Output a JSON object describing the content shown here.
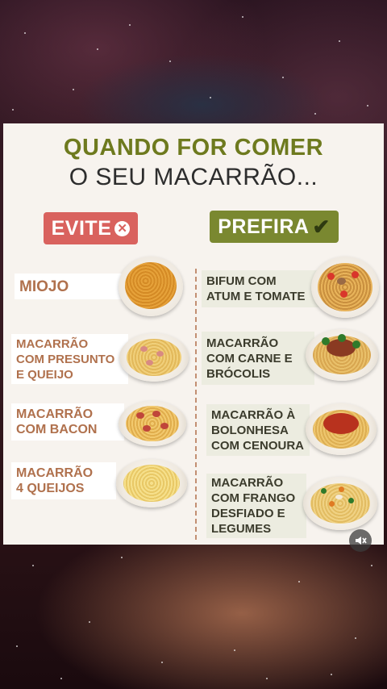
{
  "title": {
    "line1": "QUANDO FOR COMER",
    "line2": "O SEU MACARRÃO..."
  },
  "evite": {
    "label": "EVITE",
    "items": [
      {
        "text": "MIOJO"
      },
      {
        "text": "MACARRÃO\nCOM PRESUNTO\nE QUEIJO"
      },
      {
        "text": "MACARRÃO\nCOM BACON"
      },
      {
        "text": "MACARRÃO\n4 QUEIJOS"
      }
    ]
  },
  "prefira": {
    "label": "PREFIRA",
    "items": [
      {
        "text": "BIFUM COM\nATUM E TOMATE"
      },
      {
        "text": "MACARRÃO\nCOM CARNE E\nBRÓCOLIS"
      },
      {
        "text": "MACARRÃO À\nBOLONHESA\nCOM CENOURA"
      },
      {
        "text": "MACARRÃO\nCOM FRANGO\nDESFIADO E\nLEGUMES"
      }
    ]
  },
  "colors": {
    "title_green": "#6e7a1e",
    "evite_red": "#d9625e",
    "prefira_green": "#7a8830",
    "card_bg": "#f7f3ee"
  },
  "icons": {
    "evite": "x-circle-icon",
    "prefira": "check-icon",
    "overlay": "muted-sound-icon"
  }
}
